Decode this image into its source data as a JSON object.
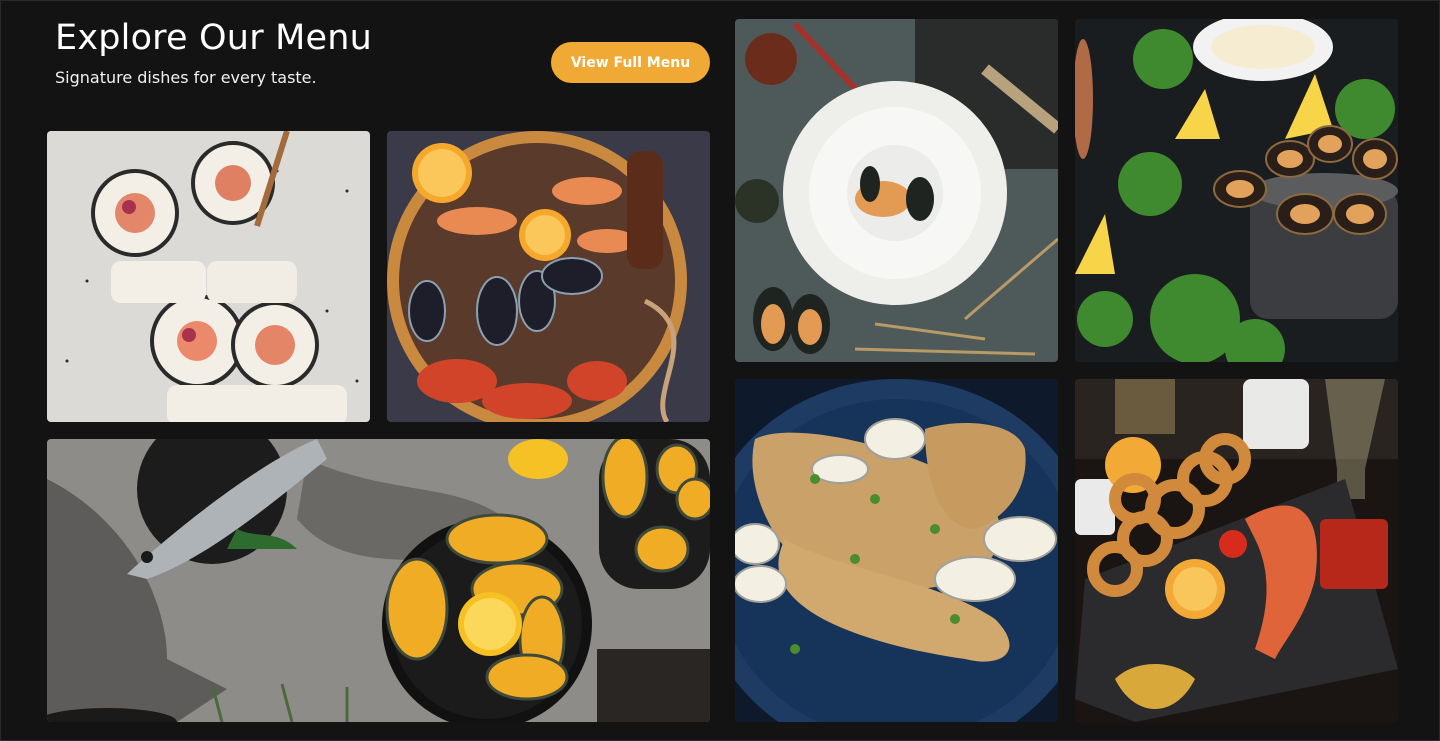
{
  "header": {
    "title": "Explore Our Menu",
    "subtitle": "Signature dishes for every taste.",
    "cta_label": "View Full Menu"
  },
  "theme": {
    "background": "#131313",
    "accent": "#f0a935",
    "text": "#ffffff"
  },
  "gallery": {
    "items": [
      {
        "dish": "sushi-rolls-photo"
      },
      {
        "dish": "seafood-platter-photo"
      },
      {
        "dish": "sea-bass-and-mussels-photo"
      },
      {
        "dish": "plated-mussel-photo"
      },
      {
        "dish": "mussels-pot-photo"
      },
      {
        "dish": "grilled-fish-with-clams-photo"
      },
      {
        "dish": "fried-calamari-and-shrimp-photo"
      }
    ]
  }
}
